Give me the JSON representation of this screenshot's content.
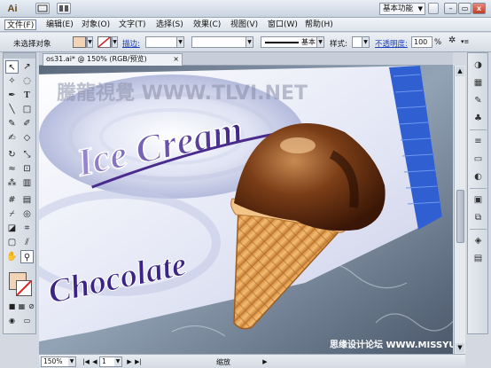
{
  "titlebar": {
    "app_logo": "Ai",
    "workspace_label": "基本功能",
    "buttons": {
      "minimize": "–",
      "restore": "▭",
      "close": "x"
    }
  },
  "menu": {
    "items": [
      "文件(F)",
      "编辑(E)",
      "对象(O)",
      "文字(T)",
      "选择(S)",
      "效果(C)",
      "视图(V)",
      "窗口(W)",
      "帮助(H)"
    ]
  },
  "control": {
    "selection_label": "未选择对象",
    "stroke_label": "描边:",
    "brush_label": "基本",
    "style_label": "样式:",
    "opacity_label": "不透明度:",
    "opacity_value": "100",
    "opacity_unit": "%"
  },
  "doc": {
    "tab_title": "os31.ai* @ 150% (RGB/预览)",
    "tab_close": "×"
  },
  "artwork": {
    "watermark_top": "騰龍視覺 WWW.TLVI.NET",
    "headline": "Ice Cream",
    "subtitle": "Chocolate",
    "watermark_bottom": "思缘设计论坛 WWW.MISSYUAN.COM",
    "colors": {
      "wrapper_white": "#eef0f8",
      "wrapper_blue": "#2f5fd0",
      "title_purple": "#4a2a8c",
      "cone": "#e8a85a",
      "chocolate": "#5a2a10"
    }
  },
  "statusbar": {
    "zoom": "150%",
    "page": "1",
    "mode": "缩放"
  },
  "icons": {
    "tools": [
      "selection-arrow",
      "direct-selection",
      "magic-wand",
      "lasso",
      "pen",
      "type",
      "line",
      "rectangle",
      "paintbrush",
      "pencil",
      "blob-brush",
      "eraser",
      "rotate",
      "scale",
      "warp",
      "free-transform",
      "symbol-sprayer",
      "graph",
      "mesh",
      "gradient",
      "eyedropper",
      "blend",
      "live-paint",
      "crop",
      "artboard",
      "slice",
      "hand",
      "zoom"
    ],
    "dock": [
      "color-icon",
      "swatches-icon",
      "brushes-icon",
      "symbols-icon",
      "stroke-icon",
      "gradient-icon",
      "transparency-icon",
      "appearance-icon",
      "graphic-styles-icon",
      "layers-icon",
      "artboards-icon"
    ]
  }
}
